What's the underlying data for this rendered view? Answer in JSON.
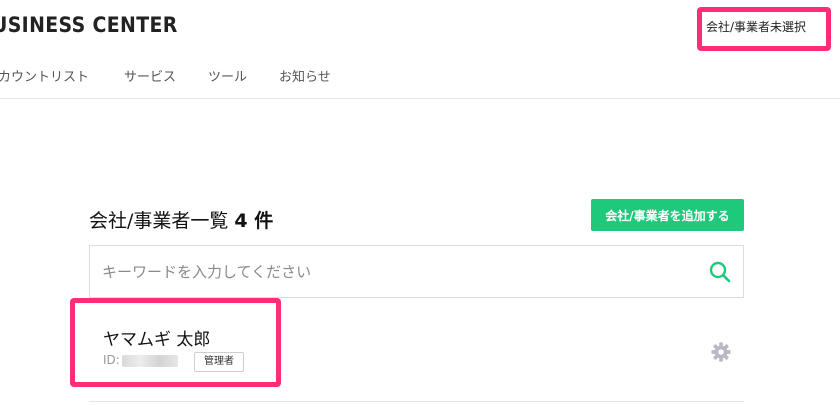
{
  "header": {
    "brand": "USINESS CENTER",
    "account_selector": "会社/事業者未選択"
  },
  "nav": {
    "items": [
      {
        "label": "カウントリスト"
      },
      {
        "label": "サービス"
      },
      {
        "label": "ツール"
      },
      {
        "label": "お知らせ"
      }
    ]
  },
  "main": {
    "title": "会社/事業者一覧",
    "count": "4 件",
    "add_button": "会社/事業者を追加する",
    "search": {
      "placeholder": "キーワードを入力してください",
      "value": "",
      "icon": "search-icon"
    },
    "companies": [
      {
        "name": "ヤマムギ 太郎",
        "id_label": "ID:",
        "role": "管理者",
        "settings_icon": "gear-icon"
      }
    ]
  },
  "colors": {
    "accent_green": "#1ec97b",
    "highlight_pink": "#ff2d77"
  }
}
